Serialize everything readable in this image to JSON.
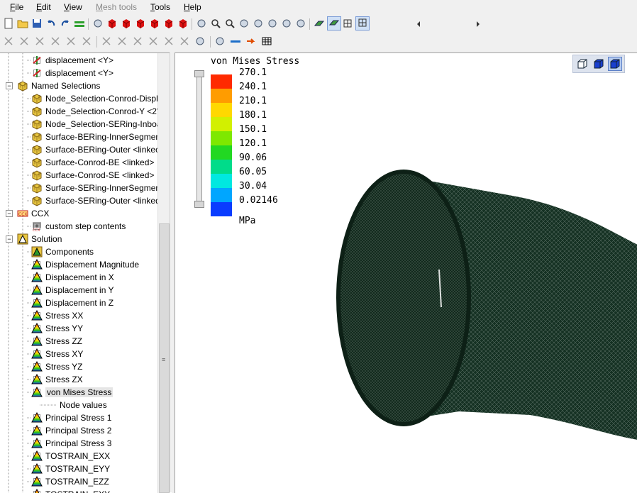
{
  "menubar": {
    "items": [
      {
        "label": "File",
        "u": "F",
        "rest": "ile",
        "enabled": true
      },
      {
        "label": "Edit",
        "u": "E",
        "rest": "dit",
        "enabled": true
      },
      {
        "label": "View",
        "u": "V",
        "rest": "iew",
        "enabled": true
      },
      {
        "label": "Mesh tools",
        "u": "M",
        "rest": "esh tools",
        "enabled": false
      },
      {
        "label": "Tools",
        "u": "T",
        "rest": "ools",
        "enabled": true
      },
      {
        "label": "Help",
        "u": "H",
        "rest": "elp",
        "enabled": true
      }
    ]
  },
  "toolbar1": [
    "new-file-icon",
    "open-folder-icon",
    "save-icon",
    "undo-icon",
    "redo-icon",
    "line-style-icon",
    "mesh-sphere-icon",
    "box-red-1-icon",
    "box-red-2-icon",
    "box-red-3-icon",
    "box-red-4-icon",
    "box-red-5-icon",
    "box-red-6-icon",
    "fit-view-icon",
    "zoom-icon",
    "zoom-box-icon",
    "rotate-icon",
    "pan-icon",
    "light-icon",
    "coordinate-icon",
    "clip-plane-icon",
    "surface-icon",
    "shaded-icon",
    "wireframe-icon",
    "mesh-icon"
  ],
  "toolbar2": [
    "select-node-icon",
    "select-element-icon",
    "select-face-icon",
    "select-edge-icon",
    "select-solid-icon",
    "select-shell-icon",
    "select-beam-icon",
    "select-spring-icon",
    "select-point-icon",
    "select-region-icon",
    "select-volume-icon",
    "select-path-icon",
    "hide-icon",
    "show-icon",
    "plane-icon",
    "arrow-icon",
    "table-icon"
  ],
  "tree": {
    "items": [
      {
        "label": "displacement <Y>",
        "icon": "displacement-icon",
        "level": 2
      },
      {
        "label": "displacement <Y>",
        "icon": "displacement-icon",
        "level": 2
      },
      {
        "label": "Named Selections",
        "icon": "named-selection-icon",
        "level": 1
      },
      {
        "label": "Node_Selection-Conrod-Displ",
        "icon": "selection-set-icon",
        "level": 2
      },
      {
        "label": "Node_Selection-Conrod-Y <2'",
        "icon": "selection-set-icon",
        "level": 2
      },
      {
        "label": "Node_Selection-SERing-Inboa",
        "icon": "selection-set-icon",
        "level": 2
      },
      {
        "label": "Surface-BERing-InnerSegmen",
        "icon": "selection-set-icon",
        "level": 2
      },
      {
        "label": "Surface-BERing-Outer <linkec",
        "icon": "selection-set-icon",
        "level": 2
      },
      {
        "label": "Surface-Conrod-BE <linked>",
        "icon": "selection-set-icon",
        "level": 2
      },
      {
        "label": "Surface-Conrod-SE <linked>",
        "icon": "selection-set-icon",
        "level": 2
      },
      {
        "label": "Surface-SERing-InnerSegment",
        "icon": "selection-set-icon",
        "level": 2
      },
      {
        "label": "Surface-SERing-Outer <linked",
        "icon": "selection-set-icon",
        "level": 2
      },
      {
        "label": "CCX",
        "icon": "ccx-icon",
        "level": 1
      },
      {
        "label": "custom step contents",
        "icon": "ccx-step-icon",
        "level": 2
      },
      {
        "label": "Solution",
        "icon": "solution-icon",
        "level": 1
      },
      {
        "label": "Components",
        "icon": "components-icon",
        "level": 2
      },
      {
        "label": "Displacement Magnitude",
        "icon": "result-icon",
        "level": 2
      },
      {
        "label": "Displacement in X",
        "icon": "result-icon",
        "level": 2
      },
      {
        "label": "Displacement in Y",
        "icon": "result-icon",
        "level": 2
      },
      {
        "label": "Displacement in Z",
        "icon": "result-icon",
        "level": 2
      },
      {
        "label": "Stress XX",
        "icon": "result-icon",
        "level": 2
      },
      {
        "label": "Stress YY",
        "icon": "result-icon",
        "level": 2
      },
      {
        "label": "Stress ZZ",
        "icon": "result-icon",
        "level": 2
      },
      {
        "label": "Stress XY",
        "icon": "result-icon",
        "level": 2
      },
      {
        "label": "Stress YZ",
        "icon": "result-icon",
        "level": 2
      },
      {
        "label": "Stress ZX",
        "icon": "result-icon",
        "level": 2
      },
      {
        "label": "von Mises Stress",
        "icon": "result-icon",
        "level": 2,
        "selected": true
      },
      {
        "label": "Node values",
        "icon": "",
        "level": 3
      },
      {
        "label": "Principal Stress 1",
        "icon": "result-icon",
        "level": 2
      },
      {
        "label": "Principal Stress 2",
        "icon": "result-icon",
        "level": 2
      },
      {
        "label": "Principal Stress 3",
        "icon": "result-icon",
        "level": 2
      },
      {
        "label": "TOSTRAIN_EXX",
        "icon": "result-icon",
        "level": 2
      },
      {
        "label": "TOSTRAIN_EYY",
        "icon": "result-icon",
        "level": 2
      },
      {
        "label": "TOSTRAIN_EZZ",
        "icon": "result-icon",
        "level": 2
      },
      {
        "label": "TOSTRAIN_EXY",
        "icon": "result-icon",
        "level": 2
      }
    ]
  },
  "legend": {
    "title": "von Mises Stress",
    "unit": "MPa",
    "values": [
      "270.1",
      "240.1",
      "210.1",
      "180.1",
      "150.1",
      "120.1",
      "90.06",
      "60.05",
      "30.04",
      "0.02146"
    ],
    "colors": [
      "#ff2a00",
      "#ff9c00",
      "#ffd800",
      "#d2f000",
      "#7ee800",
      "#22d822",
      "#00dc8a",
      "#00e8e0",
      "#00a6ff",
      "#0a3cff"
    ]
  },
  "view_buttons": [
    "view-iso-icon",
    "view-front-icon",
    "view-side-icon"
  ],
  "mesh_color": "#1f3a2b"
}
